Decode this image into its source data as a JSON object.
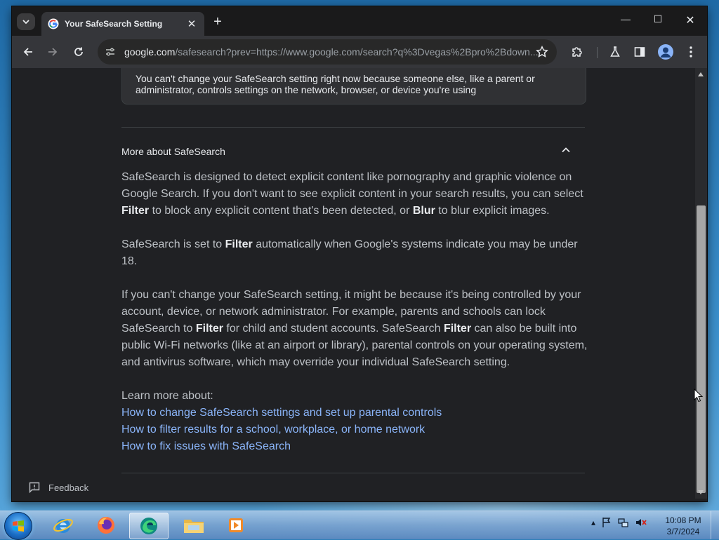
{
  "browser": {
    "tab": {
      "title": "Your SafeSearch Setting"
    },
    "address": {
      "host": "google.com",
      "path": "/safesearch?prev=https://www.google.com/search?q%3Dvegas%2Bpro%2Bdown..."
    }
  },
  "page": {
    "notice_text": "You can't change your SafeSearch setting right now because someone else, like a parent or administrator, controls settings on the network, browser, or device you're using",
    "section_title": "More about SafeSearch",
    "p1": {
      "a": "SafeSearch is designed to detect explicit content like pornography and graphic violence on Google Search. If you don't want to see explicit content in your search results, you can select ",
      "b1": "Filter",
      "c": " to block any explicit content that's been detected, or ",
      "b2": "Blur",
      "d": " to blur explicit images."
    },
    "p2": {
      "a": "SafeSearch is set to ",
      "b1": "Filter",
      "c": " automatically when Google's systems indicate you may be under 18."
    },
    "p3": {
      "a": "If you can't change your SafeSearch setting, it might be because it's being controlled by your account, device, or network administrator. For example, parents and schools can lock SafeSearch to ",
      "b1": "Filter",
      "c": " for child and student accounts. SafeSearch ",
      "b2": "Filter",
      "d": " can also be built into public Wi-Fi networks (like at an airport or library), parental controls on your operating system, and antivirus software, which may override your individual SafeSearch setting."
    },
    "learn_more": "Learn more about:",
    "links": [
      "How to change SafeSearch settings and set up parental controls",
      "How to filter results for a school, workplace, or home network",
      "How to fix issues with SafeSearch"
    ],
    "feedback": "Feedback"
  },
  "taskbar": {
    "time": "10:08 PM",
    "date": "3/7/2024"
  },
  "colors": {
    "page_bg": "#202124",
    "text": "#bdc1c6",
    "link": "#8ab4f8"
  }
}
